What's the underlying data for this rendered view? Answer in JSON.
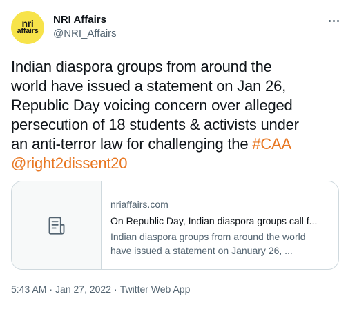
{
  "author": {
    "display_name": "NRI Affairs",
    "handle": "@NRI_Affairs",
    "avatar_logo": "nri affairs",
    "avatar_logo_line1": "nri",
    "avatar_logo_line2": "affairs",
    "avatar_color": "#f7e34a"
  },
  "more_icon": "more-horizontal-icon",
  "tweet": {
    "lines": [
      "Indian diaspora groups from around the",
      "world have issued a statement on Jan 26,",
      "Republic Day voicing concern over alleged",
      "persecution of 18 students & activists under",
      "an anti-terror law for challenging the "
    ],
    "hashtag": "#CAA",
    "mention": "@right2dissent20",
    "link_color": "#e87722"
  },
  "card": {
    "icon": "article-document-icon",
    "domain": "nriaffairs.com",
    "title": "On Republic Day, Indian diaspora groups call f...",
    "description_lines": [
      "Indian diaspora groups from around the world",
      "have issued a statement on January 26, ..."
    ]
  },
  "meta": {
    "time": "5:43 AM",
    "separator": "·",
    "date": "Jan 27, 2022",
    "source": "Twitter Web App"
  }
}
